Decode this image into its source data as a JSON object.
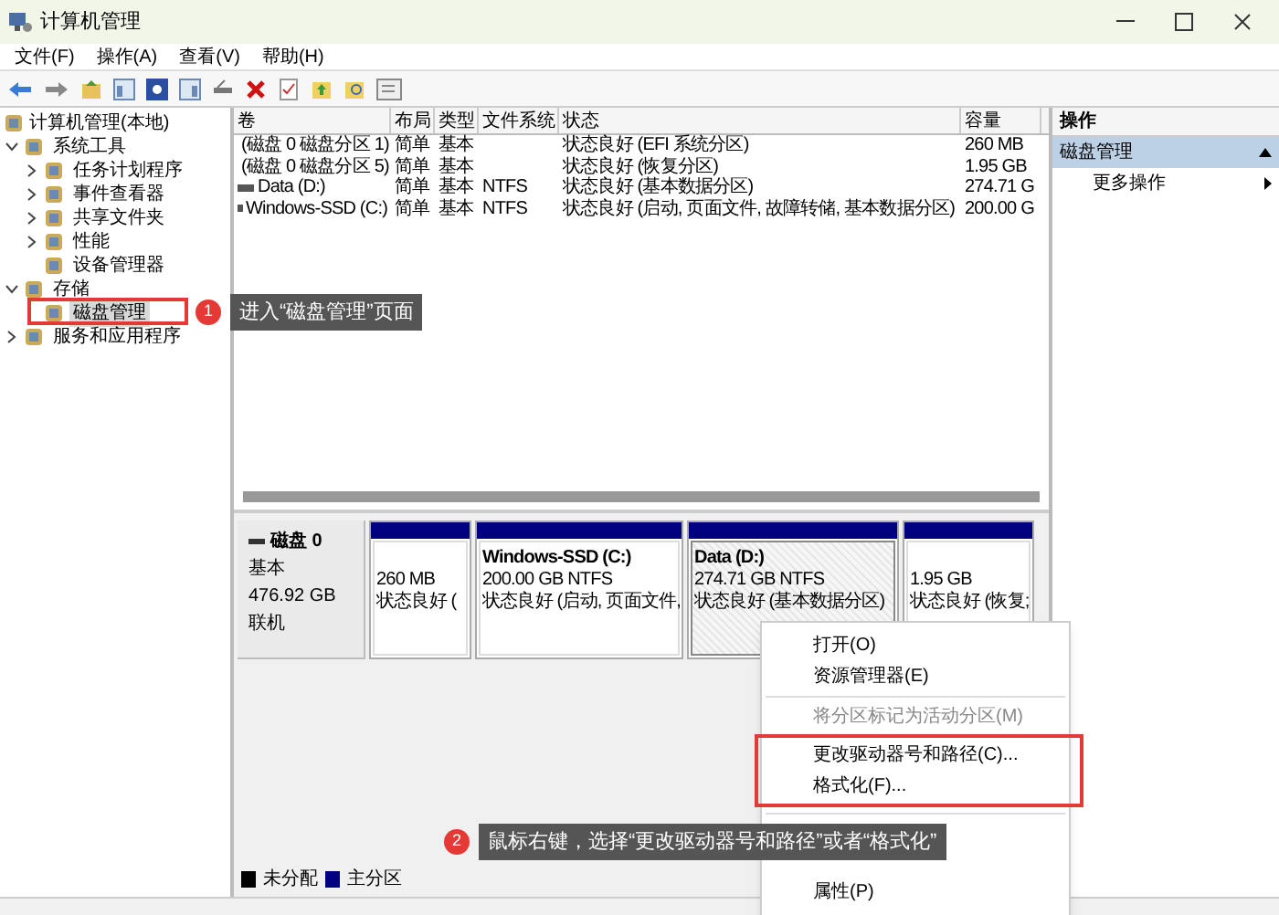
{
  "window": {
    "title": "计算机管理"
  },
  "menu_bar": [
    "文件(F)",
    "操作(A)",
    "查看(V)",
    "帮助(H)"
  ],
  "tree": {
    "label": "计算机管理(本地)",
    "children": [
      {
        "label": "系统工具",
        "expanded": true,
        "selected": false,
        "children": [
          {
            "label": "任务计划程序",
            "expanded": false,
            "selected": false
          },
          {
            "label": "事件查看器",
            "expanded": false,
            "selected": false
          },
          {
            "label": "共享文件夹",
            "expanded": false,
            "selected": false
          },
          {
            "label": "性能",
            "expanded": false,
            "selected": false
          },
          {
            "label": "设备管理器",
            "selected": false
          }
        ]
      },
      {
        "label": "存储",
        "expanded": true,
        "selected": false,
        "children": [
          {
            "label": "磁盘管理",
            "selected": true
          }
        ]
      },
      {
        "label": "服务和应用程序",
        "expanded": false,
        "selected": false
      }
    ]
  },
  "volume_table": {
    "columns": [
      "卷",
      "布局",
      "类型",
      "文件系统",
      "状态",
      "容量"
    ],
    "rows": [
      [
        "(磁盘 0 磁盘分区 1)",
        "简单",
        "基本",
        "",
        "状态良好 (EFI 系统分区)",
        "260 MB"
      ],
      [
        "(磁盘 0 磁盘分区 5)",
        "简单",
        "基本",
        "",
        "状态良好 (恢复分区)",
        "1.95 GB"
      ],
      [
        "Data (D:)",
        "简单",
        "基本",
        "NTFS",
        "状态良好 (基本数据分区)",
        "274.71 G"
      ],
      [
        "Windows-SSD (C:)",
        "简单",
        "基本",
        "NTFS",
        "状态良好 (启动, 页面文件, 故障转储, 基本数据分区)",
        "200.00 G"
      ]
    ]
  },
  "disk": {
    "name": "磁盘 0",
    "type": "基本",
    "size": "476.92 GB",
    "status": "联机",
    "partitions": [
      {
        "size": "260 MB",
        "status": "状态良好 (",
        "selected": false
      },
      {
        "title": "Windows-SSD  (C:)",
        "size": "200.00 GB NTFS",
        "status": "状态良好 (启动, 页面文件,",
        "selected": false
      },
      {
        "title": "Data  (D:)",
        "size": "274.71 GB NTFS",
        "status": "状态良好 (基本数据分区)",
        "selected": true
      },
      {
        "size": "1.95 GB",
        "status": "状态良好 (恢复;",
        "selected": false
      }
    ]
  },
  "legend": [
    {
      "label": "未分配",
      "color": "#000000"
    },
    {
      "label": "主分区",
      "color": "#000080"
    }
  ],
  "actions": {
    "title": "操作",
    "section": "磁盘管理",
    "items": [
      "更多操作"
    ]
  },
  "context_menu": [
    {
      "label": "打开(O)",
      "kind": "item",
      "disabled": false,
      "highlighted": false
    },
    {
      "label": "资源管理器(E)",
      "kind": "item",
      "disabled": false,
      "highlighted": false
    },
    {
      "kind": "separator"
    },
    {
      "label": "将分区标记为活动分区(M)",
      "kind": "item",
      "disabled": true,
      "highlighted": false
    },
    {
      "label": "更改驱动器号和路径(C)...",
      "kind": "item",
      "disabled": false,
      "highlighted": true
    },
    {
      "label": "格式化(F)...",
      "kind": "item",
      "disabled": false,
      "highlighted": true
    },
    {
      "kind": "separator"
    },
    {
      "kind": "hidden"
    },
    {
      "kind": "hidden"
    },
    {
      "label": "属性(P)",
      "kind": "item",
      "disabled": false,
      "highlighted": false
    }
  ],
  "annotations": [
    {
      "number": "1",
      "text": "进入“磁盘管理”页面"
    },
    {
      "number": "2",
      "text": "鼠标右键，选择“更改驱动器号和路径”或者“格式化”"
    }
  ]
}
